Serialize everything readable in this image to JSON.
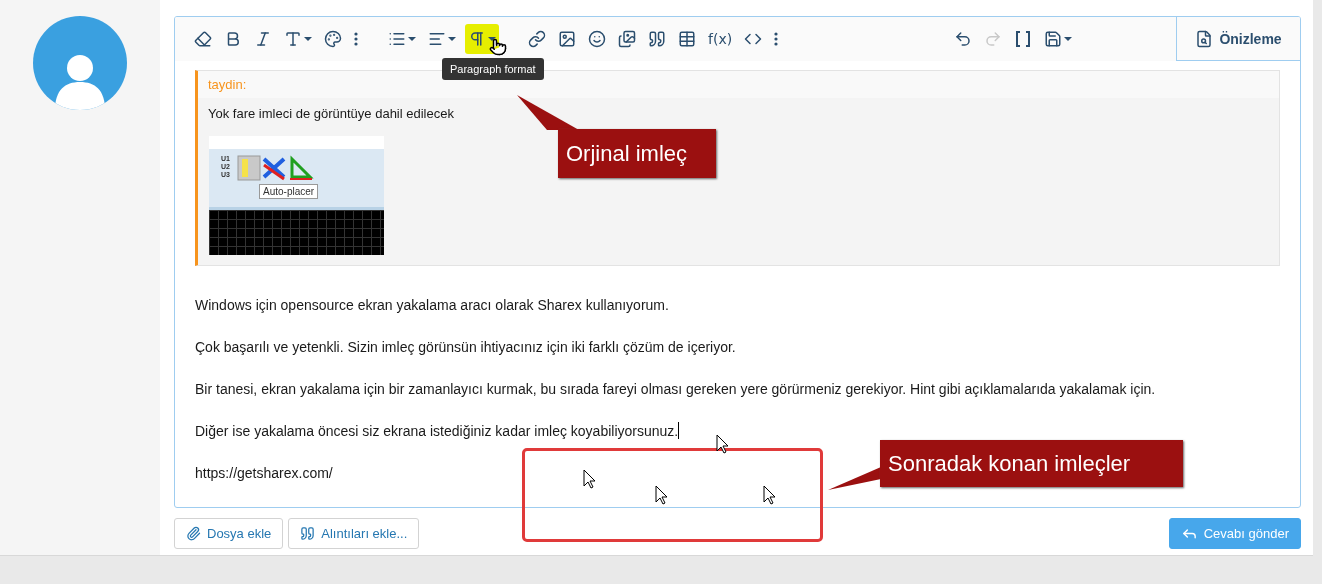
{
  "toolbar": {
    "tools": [
      {
        "disabled": false,
        "highlighted": false
      },
      {
        "disabled": false,
        "highlighted": false
      },
      {
        "disabled": false,
        "highlighted": false
      },
      {
        "disabled": false,
        "highlighted": false
      },
      {
        "disabled": false,
        "highlighted": false
      },
      {
        "disabled": false,
        "highlighted": false
      },
      {
        "disabled": false,
        "highlighted": false
      },
      {
        "disabled": false,
        "highlighted": false
      },
      {
        "disabled": false,
        "highlighted": true
      },
      {
        "disabled": false,
        "highlighted": false
      },
      {
        "disabled": false,
        "highlighted": false
      },
      {
        "disabled": false,
        "highlighted": false
      },
      {
        "disabled": false,
        "highlighted": false
      },
      {
        "disabled": false,
        "highlighted": false
      },
      {
        "disabled": false,
        "highlighted": false
      },
      {
        "disabled": false,
        "highlighted": false,
        "label": "f(x)"
      },
      {
        "disabled": false,
        "highlighted": false
      },
      {
        "disabled": false,
        "highlighted": false
      },
      {
        "disabled": false,
        "highlighted": false
      },
      {
        "disabled": true,
        "highlighted": false
      },
      {
        "disabled": false,
        "highlighted": false
      },
      {
        "disabled": false,
        "highlighted": false
      }
    ],
    "tooltip": "Paragraph format",
    "preview": "Önizleme"
  },
  "quote": {
    "author": "taydin:",
    "text": "Yok fare imleci de görüntüye dahil edilecek",
    "image": {
      "labels": [
        "U1",
        "U2",
        "U3"
      ],
      "tooltip": "Auto-placer"
    }
  },
  "paragraphs": [
    "Windows için opensource ekran yakalama aracı olarak Sharex kullanıyorum.",
    "Çok başarılı ve yetenkli. Sizin imleç görünsün ihtiyacınız için iki farklı çözüm de içeriyor.",
    "Bir tanesi, ekran yakalama için bir zamanlayıcı kurmak, bu sırada fareyi olması gereken yere görürmeniz gerekiyor. Hint gibi açıklamalarıda yakalamak için.",
    "Diğer ise yakalama öncesi siz ekrana istediğiniz kadar imleç koyabiliyorsunuz.",
    "https://getsharex.com/"
  ],
  "buttons": {
    "attach": "Dosya ekle",
    "quotes": "Alıntıları ekle...",
    "submit": "Cevabı gönder"
  },
  "annotations": [
    {
      "kind": "callout",
      "text": "Orjinal imleç"
    },
    {
      "kind": "callout",
      "text": "Sonradak konan imleçler"
    }
  ]
}
